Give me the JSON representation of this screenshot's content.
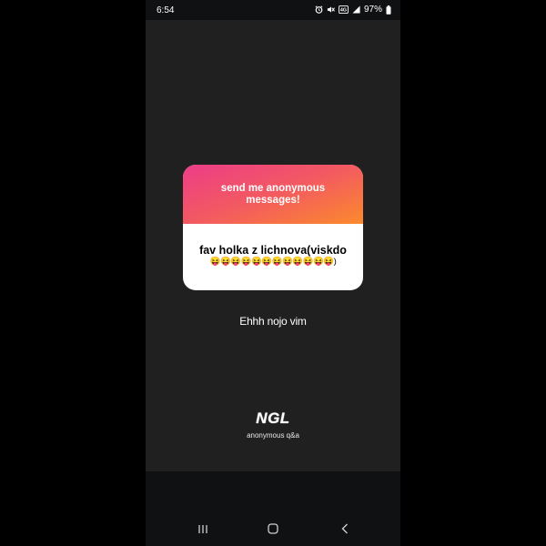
{
  "status_bar": {
    "time": "6:54",
    "battery": "97%",
    "icons": [
      "alarm-icon",
      "mute-icon",
      "wifi-calling-icon",
      "signal-icon",
      "battery-icon"
    ]
  },
  "card": {
    "prompt": "send me anonymous\nmessages!",
    "message": "fav holka z lichnova(viskdo",
    "emoji": "😝😝😝😝😝😝😝😝😝😝😝😝)",
    "gradient": [
      "#ec3d88",
      "#f35a60",
      "#fb8a2c"
    ]
  },
  "reply": "Ehhh nojo vim",
  "brand": {
    "logo": "NGL",
    "tagline": "anonymous q&a"
  },
  "nav": {
    "icons": [
      "recent-apps-icon",
      "home-icon",
      "back-icon"
    ]
  }
}
